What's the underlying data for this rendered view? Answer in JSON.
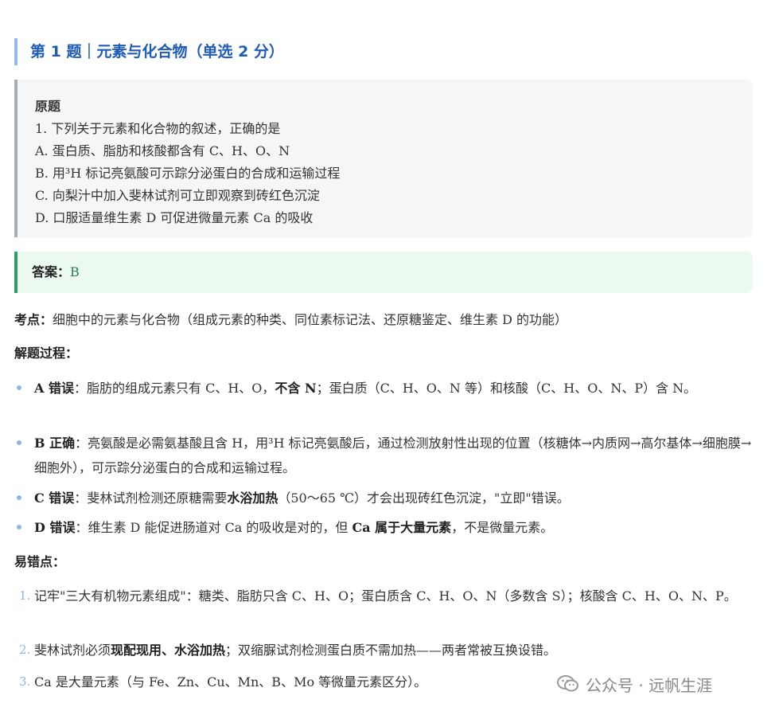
{
  "title": "第 1 题｜元素与化合物（单选 2 分）",
  "original": {
    "heading": "原题",
    "lines": [
      "1. 下列关于元素和化合物的叙述，正确的是",
      "A. 蛋白质、脂肪和核酸都含有 C、H、O、N",
      "B. 用³H 标记亮氨酸可示踪分泌蛋白的合成和运输过程",
      "C. 向梨汁中加入斐林试剂可立即观察到砖红色沉淀",
      "D. 口服适量维生素 D 可促进微量元素 Ca 的吸收"
    ]
  },
  "answer": {
    "label": "答案：",
    "value": "B"
  },
  "kaodian": {
    "label": "考点：",
    "text": "细胞中的元素与化合物（组成元素的种类、同位素标记法、还原糖鉴定、维生素 D 的功能）"
  },
  "process": {
    "label": "解题过程：",
    "items": [
      {
        "head": "A 错误",
        "p1": "：脂肪的组成元素只有 C、H、O，",
        "bold": "不含 N",
        "p2": "；蛋白质（C、H、O、N 等）和核酸（C、H、O、N、P）含 N。"
      },
      {
        "head": "B 正确",
        "p1": "：亮氨酸是必需氨基酸且含 H，用³H 标记亮氨酸后，通过检测放射性出现的位置（核糖体→内质网→高尔基体→细胞膜→细胞外），可示踪分泌蛋白的合成和运输过程。",
        "bold": "",
        "p2": ""
      },
      {
        "head": "C 错误",
        "p1": "：斐林试剂检测还原糖需要",
        "bold": "水浴加热",
        "p2": "（50～65 ℃）才会出现砖红色沉淀，\"立即\"错误。"
      },
      {
        "head": "D 错误",
        "p1": "：维生素 D 能促进肠道对 Ca 的吸收是对的，但 ",
        "bold": "Ca 属于大量元素",
        "p2": "，不是微量元素。"
      }
    ]
  },
  "pitfalls": {
    "label": "易错点：",
    "items": [
      {
        "num": "1.",
        "p1": "记牢\"三大有机物元素组成\"：糖类、脂肪只含 C、H、O；蛋白质含 C、H、O、N（多数含 S）；核酸含 C、H、O、N、P。",
        "bold": "",
        "p2": ""
      },
      {
        "num": "2.",
        "p1": "斐林试剂必须",
        "bold": "现配现用、水浴加热",
        "p2": "；双缩脲试剂检测蛋白质不需加热——两者常被互换设错。"
      },
      {
        "num": "3.",
        "p1": "Ca 是大量元素（与 Fe、Zn、Cu、Mn、B、Mo 等微量元素区分）。",
        "bold": "",
        "p2": ""
      }
    ]
  },
  "watermark": {
    "text": "公众号 · 远帆生涯",
    "icon": "wechat-icon"
  }
}
